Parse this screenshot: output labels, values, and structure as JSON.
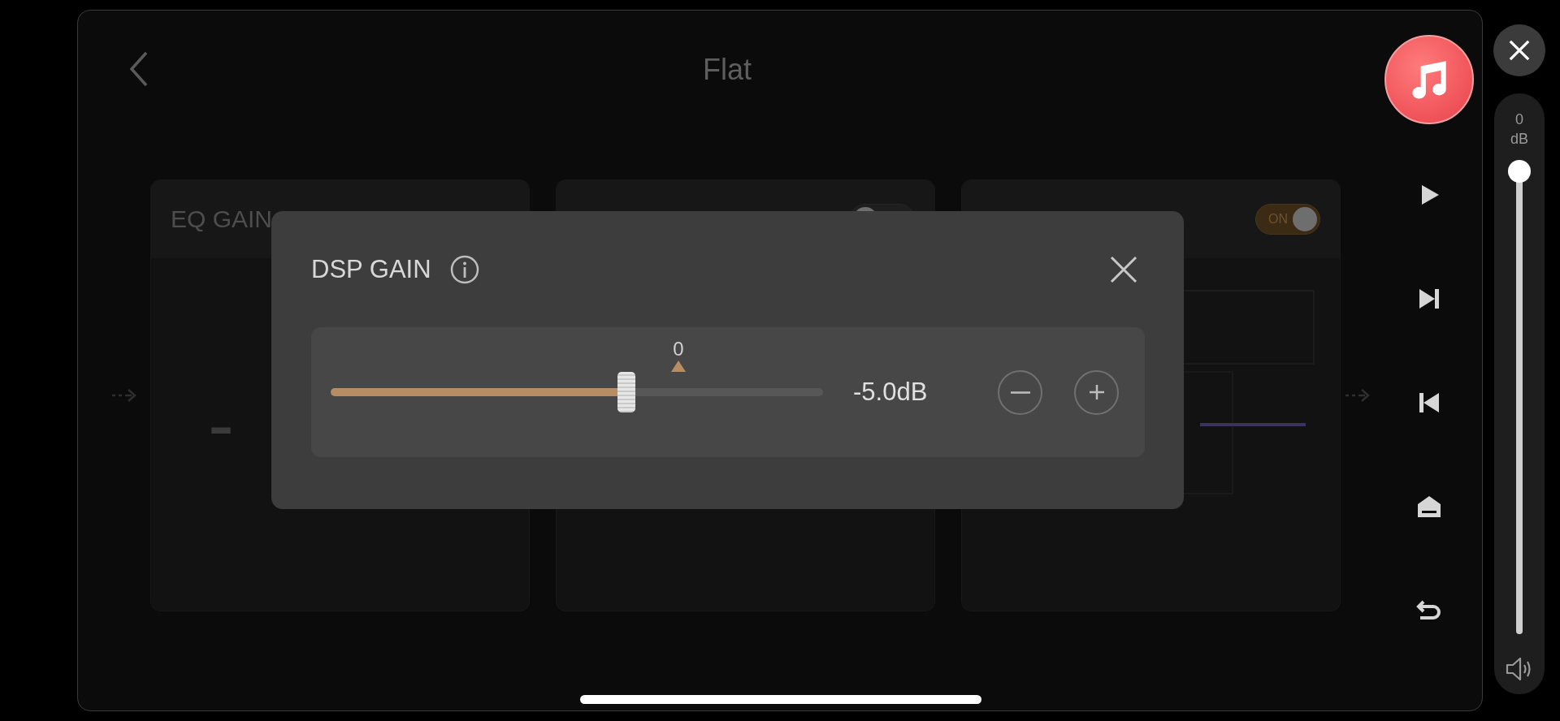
{
  "screen": {
    "title": "Flat"
  },
  "cards": [
    {
      "kind": "value",
      "title": "EQ GAIN",
      "value": "-"
    },
    {
      "kind": "curve",
      "toggle": {
        "on": false
      }
    },
    {
      "kind": "curve",
      "toggle": {
        "on": true,
        "label": "ON"
      }
    }
  ],
  "dialog": {
    "title": "DSP GAIN",
    "marker": "0",
    "slider": {
      "level": 0.6
    },
    "reading": "-5.0dB"
  },
  "volume": {
    "value": "0",
    "unit": "dB",
    "level": 1
  }
}
